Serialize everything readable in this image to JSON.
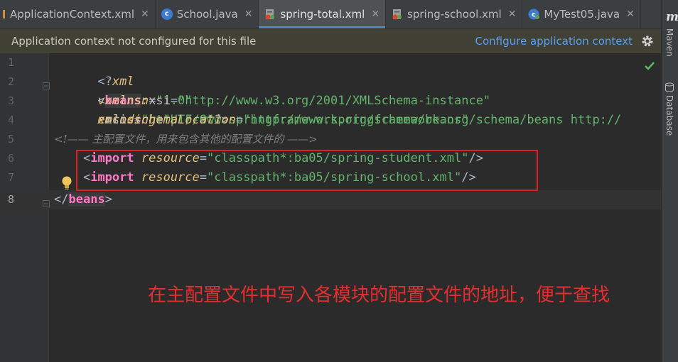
{
  "tabs": [
    {
      "label": "ApplicationContext.xml",
      "icon": "xml-file-icon",
      "active": false
    },
    {
      "label": "School.java",
      "icon": "java-class-icon",
      "active": false
    },
    {
      "label": "spring-total.xml",
      "icon": "spring-xml-icon",
      "active": true
    },
    {
      "label": "spring-school.xml",
      "icon": "spring-xml-icon",
      "active": false
    },
    {
      "label": "MyTest05.java",
      "icon": "java-class-icon",
      "active": false
    }
  ],
  "close_glyph": "✕",
  "banner": {
    "text": "Application context not configured for this file",
    "link": "Configure application context"
  },
  "line_numbers": [
    "1",
    "2",
    "3",
    "4",
    "5",
    "6",
    "7",
    "8"
  ],
  "code": {
    "l1": {
      "open": "<?",
      "name": "xml",
      "a1": "version",
      "v1": "\"1.0\"",
      "a2": "encoding",
      "v2": "\"UTF-8\"",
      "close": "?>"
    },
    "l2": {
      "lt": "<",
      "tag": "beans",
      "attr": "xmlns",
      "eq": "=",
      "val": "\"http://www.springframework.org/schema/beans\""
    },
    "l3": {
      "attr_ns": "xmlns",
      "attr_colon": ":",
      "attr_local": "xsi",
      "eq": "=",
      "val": "\"http://www.w3.org/2001/XMLSchema-instance\""
    },
    "l4": {
      "attr_ns": "xsi",
      "attr_colon": ":",
      "attr_local": "schemaLocation",
      "eq": "=",
      "val": "\"http://www.springframework.org/schema/beans http://"
    },
    "l5": {
      "comment": "<!—— 主配置文件，用来包含其他的配置文件的 ——>"
    },
    "l6": {
      "lt": "<",
      "tag": "import",
      "attr": "resource",
      "eq": "=",
      "val": "\"classpath*:ba05/spring-student.xml\"",
      "end": "/>"
    },
    "l7": {
      "lt": "<",
      "tag": "import",
      "attr": "resource",
      "eq": "=",
      "val": "\"classpath*:ba05/spring-school.xml\"",
      "end": "/>"
    },
    "l8": {
      "lt": "</",
      "tag": "beans",
      "gt": ">"
    }
  },
  "annotation": "在主配置文件中写入各模块的配置文件的地址，便于查找",
  "sidebar": {
    "maven_glyph": "m",
    "maven": "Maven",
    "database": "Database"
  },
  "colors": {
    "highlight_box": "#e02020",
    "annotation": "#e62e2e",
    "accent": "#4a88c7"
  }
}
